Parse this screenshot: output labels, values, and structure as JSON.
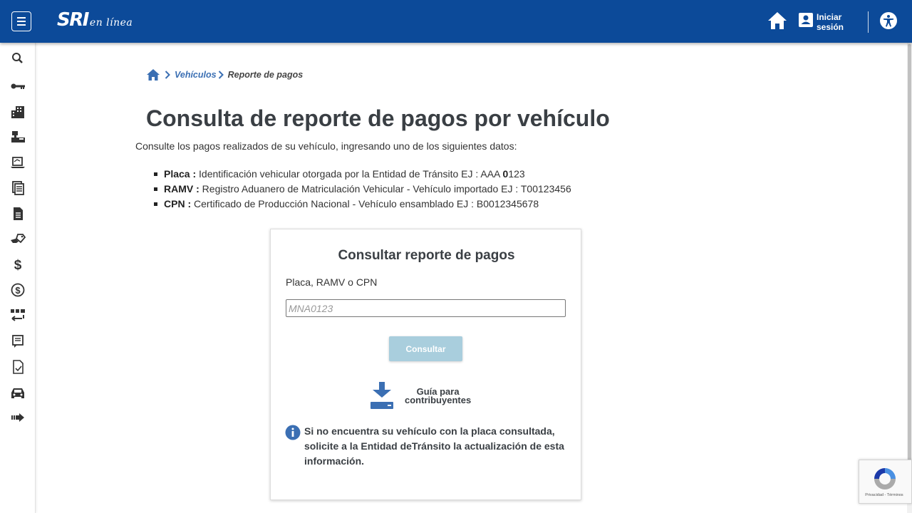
{
  "header": {
    "logo_main": "SRI",
    "logo_sub": "en línea",
    "login_line1": "Iniciar",
    "login_line2": "sesión"
  },
  "sidebar": {
    "icons": [
      "search-icon",
      "key-icon",
      "buildings-icon",
      "cash-register-icon",
      "laptop-icon",
      "documents-icon",
      "document-icon",
      "hand-tag-icon",
      "dollar-icon",
      "coin-dollar-icon",
      "transfer-icon",
      "receipt-icon",
      "checklist-icon",
      "car-icon",
      "arrow-right-icon"
    ]
  },
  "breadcrumb": {
    "link": "Vehículos",
    "current": "Reporte de pagos"
  },
  "page": {
    "title": "Consulta de reporte de pagos por vehículo",
    "intro": "Consulte los pagos realizados de su vehículo, ingresando uno de los siguientes datos:",
    "defs": [
      {
        "term": "Placa :",
        "desc_pre": " Identificación vehicular otorgada por la Entidad de Tránsito EJ : AAA ",
        "desc_bold": "0",
        "desc_post": "123"
      },
      {
        "term": "RAMV :",
        "desc": " Registro Aduanero de Matriculación Vehicular - Vehículo importado EJ : T00123456"
      },
      {
        "term": "CPN :",
        "desc": " Certificado de Producción Nacional - Vehículo ensamblado EJ : B0012345678"
      }
    ]
  },
  "card": {
    "title": "Consultar reporte de pagos",
    "field_label": "Placa, RAMV o CPN",
    "field_placeholder": "MNA0123",
    "field_value": "",
    "button_label": "Consultar",
    "guide_line1": "Guía para",
    "guide_line2": "contribuyentes",
    "info_text": "Si no encuentra su vehículo con la placa consultada, solicite a la Entidad deTránsito la actualización de esta información."
  },
  "recaptcha": {
    "links": "Privacidad - Términos"
  },
  "colors": {
    "header_bg": "#0c4a99",
    "link": "#3b6fb3",
    "button_disabled": "#a9cedd",
    "icon_blue": "#3b6fb3"
  }
}
